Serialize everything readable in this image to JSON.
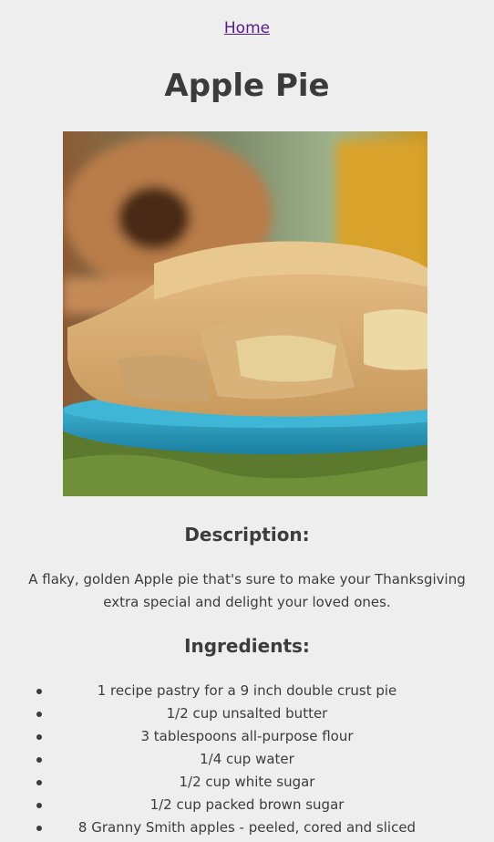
{
  "nav": {
    "home_label": "Home"
  },
  "page": {
    "title": "Apple Pie"
  },
  "image": {
    "alt": "Apple Pie"
  },
  "description": {
    "heading": "Description:",
    "text": "A flaky, golden Apple pie that's sure to make your Thanksgiving extra special and delight your loved ones."
  },
  "ingredients": {
    "heading": "Ingredients:",
    "items": [
      "1 recipe pastry for a 9 inch double crust pie",
      "1/2 cup unsalted butter",
      "3 tablespoons all-purpose flour",
      "1/4 cup water",
      "1/2 cup white sugar",
      "1/2 cup packed brown sugar",
      "8 Granny Smith apples - peeled, cored and sliced"
    ]
  },
  "colors": {
    "background": "#eeeeee",
    "text": "#3c3c3c",
    "link": "#551a8b"
  }
}
